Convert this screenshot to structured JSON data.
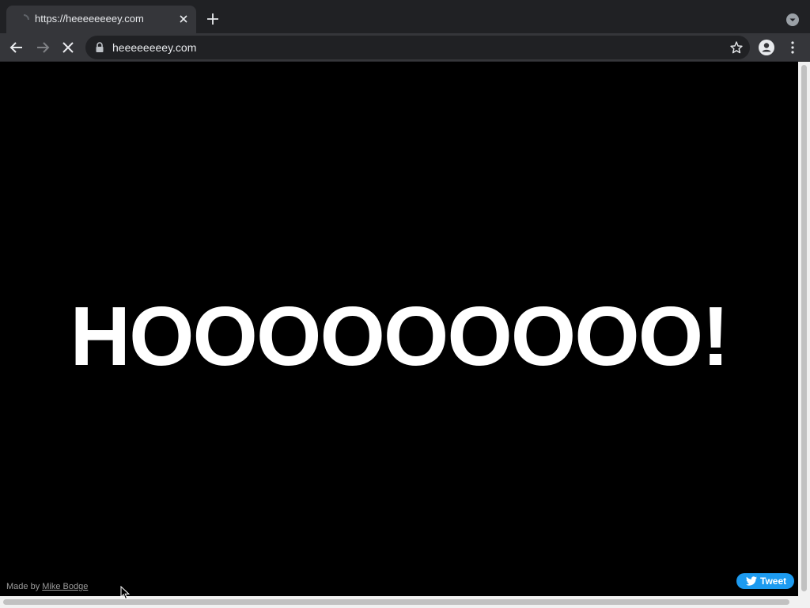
{
  "tab": {
    "title": "https://heeeeeeeey.com"
  },
  "toolbar": {
    "url": "heeeeeeeey.com"
  },
  "page": {
    "headline": "HOOOOOOOOO!",
    "credit_prefix": "Made by",
    "credit_link": "Mike Bodge",
    "tweet_label": "Tweet"
  },
  "colors": {
    "tabstrip": "#202124",
    "toolbar": "#35363a",
    "page_background": "#000000",
    "headline": "#ffffff",
    "tweet_button": "#1d9bf0"
  },
  "icons": {
    "favicon": "loading-favicon-icon",
    "tab_close": "close-icon",
    "new_tab": "plus-icon",
    "tab_search": "chevron-down-circle-icon",
    "back": "arrow-left-icon",
    "forward": "arrow-right-icon",
    "stop": "close-icon",
    "lock": "lock-icon",
    "bookmark": "star-icon",
    "profile": "person-icon",
    "menu": "kebab-menu-icon",
    "tweet": "twitter-bird-icon"
  }
}
